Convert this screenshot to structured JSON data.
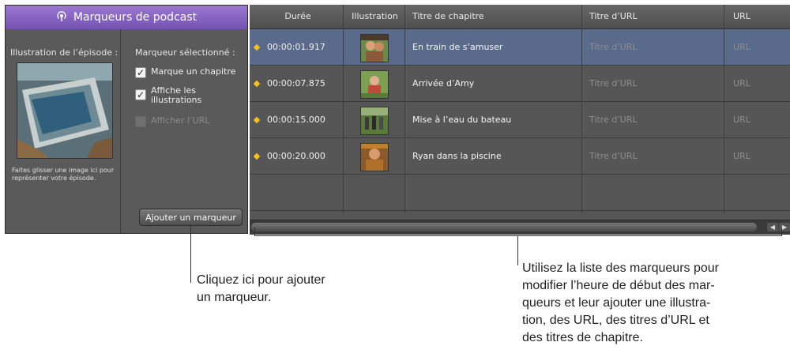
{
  "panel": {
    "title": "Marqueurs de podcast",
    "art_label": "Illustration de l’épisode :",
    "art_hint": "Faites glisser une image ici pour représenter votre épisode.",
    "marker_label": "Marqueur sélectionné :",
    "checkboxes": [
      {
        "label": "Marque un chapitre",
        "checked": true,
        "enabled": true
      },
      {
        "label": "Affiche les illustrations",
        "checked": true,
        "enabled": true
      },
      {
        "label": "Afficher l’URL",
        "checked": false,
        "enabled": false
      }
    ],
    "add_button": "Ajouter un marqueur",
    "accent_color": "#8a66c6"
  },
  "table": {
    "headers": [
      "Durée",
      "Illustration",
      "Titre de chapitre",
      "Titre d’URL",
      "URL"
    ],
    "rows": [
      {
        "duration": "00:00:01.917",
        "chapter_title": "En train de s’amuser",
        "url_title": "Titre d’URL",
        "url": "URL",
        "selected": true
      },
      {
        "duration": "00:00:07.875",
        "chapter_title": "Arrivée d’Amy",
        "url_title": "Titre d’URL",
        "url": "URL",
        "selected": false
      },
      {
        "duration": "00:00:15.000",
        "chapter_title": "Mise à l’eau du bateau",
        "url_title": "Titre d’URL",
        "url": "URL",
        "selected": false
      },
      {
        "duration": "00:00:20.000",
        "chapter_title": "Ryan dans la piscine",
        "url_title": "Titre d’URL",
        "url": "URL",
        "selected": false
      }
    ],
    "marker_color": "#f5c020",
    "selected_row_color": "#5a6a8a"
  },
  "callouts": {
    "add_marker": [
      "Cliquez ici pour ajouter",
      "un marqueur."
    ],
    "marker_list": [
      "Utilisez la liste des marqueurs pour",
      "modifier l’heure de début des mar-",
      "queurs et leur ajouter une illustra-",
      "tion, des URL, des titres d’URL et",
      "des titres de chapitre."
    ]
  }
}
